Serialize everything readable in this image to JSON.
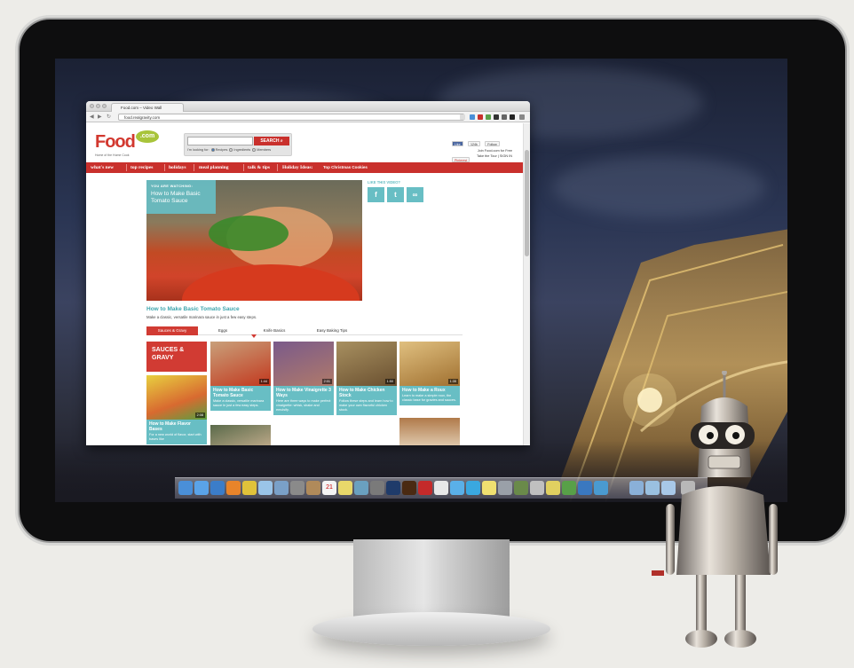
{
  "browser": {
    "tab_title": "Food.com – Video Wall",
    "url": "food.realgravity.com"
  },
  "site": {
    "logo_text": "Food",
    "logo_suffix": ".com",
    "tagline": "Home of the Home Cook",
    "search": {
      "button": "SEARCH",
      "looking_for": "I'm looking for:",
      "options": [
        "Recipes",
        "Ingredients",
        "Members"
      ]
    },
    "social_top": [
      "Like",
      "124k",
      "Follow",
      "Pinterest"
    ],
    "join": [
      "Join Food.com for Free",
      "Take the Tour | SIGN IN"
    ],
    "nav": [
      "what's new",
      "top recipes",
      "holidays",
      "meal planning",
      "talk & tips"
    ],
    "holiday_label": "Holiday Ideas:",
    "holiday_link": "Top Christmas Cookies"
  },
  "video": {
    "watching_label": "YOU ARE WATCHING:",
    "watching_title": "How to Make Basic Tomato Sauce",
    "like_label": "LIKE THIS VIDEO?",
    "like_buttons": [
      "f",
      "t",
      "∞"
    ],
    "title": "How to Make Basic Tomato Sauce",
    "description": "Make a classic, versatile marinara sauce in just a few easy steps."
  },
  "tabs": [
    "Sauces & Gravy",
    "Eggs",
    "Knife Basics",
    "Easy Baking Tips"
  ],
  "section_heading": "SAUCES & GRAVY",
  "cards": [
    {
      "title": "How to Make Basic Tomato Sauce",
      "desc": "Make a classic, versatile marinara sauce in just a few easy steps.",
      "duration": "1:44"
    },
    {
      "title": "How to Make Vinaigrette 3 Ways",
      "desc": "Here are three ways to make perfect vinaigrette: whisk, shake and emulsify.",
      "duration": "2:01"
    },
    {
      "title": "How to Make Chicken Stock",
      "desc": "Follow these steps and learn how to make your own flavorful chicken stock.",
      "duration": "1:50"
    },
    {
      "title": "How to Make a Roux",
      "desc": "Learn to make a simple roux, the classic base for gravies and sauces.",
      "duration": "1:35"
    },
    {
      "title": "How to Make Flavor Bases",
      "desc": "For a new world of flavor, start with bases like",
      "duration": "2:08"
    }
  ],
  "dock_date": "21"
}
